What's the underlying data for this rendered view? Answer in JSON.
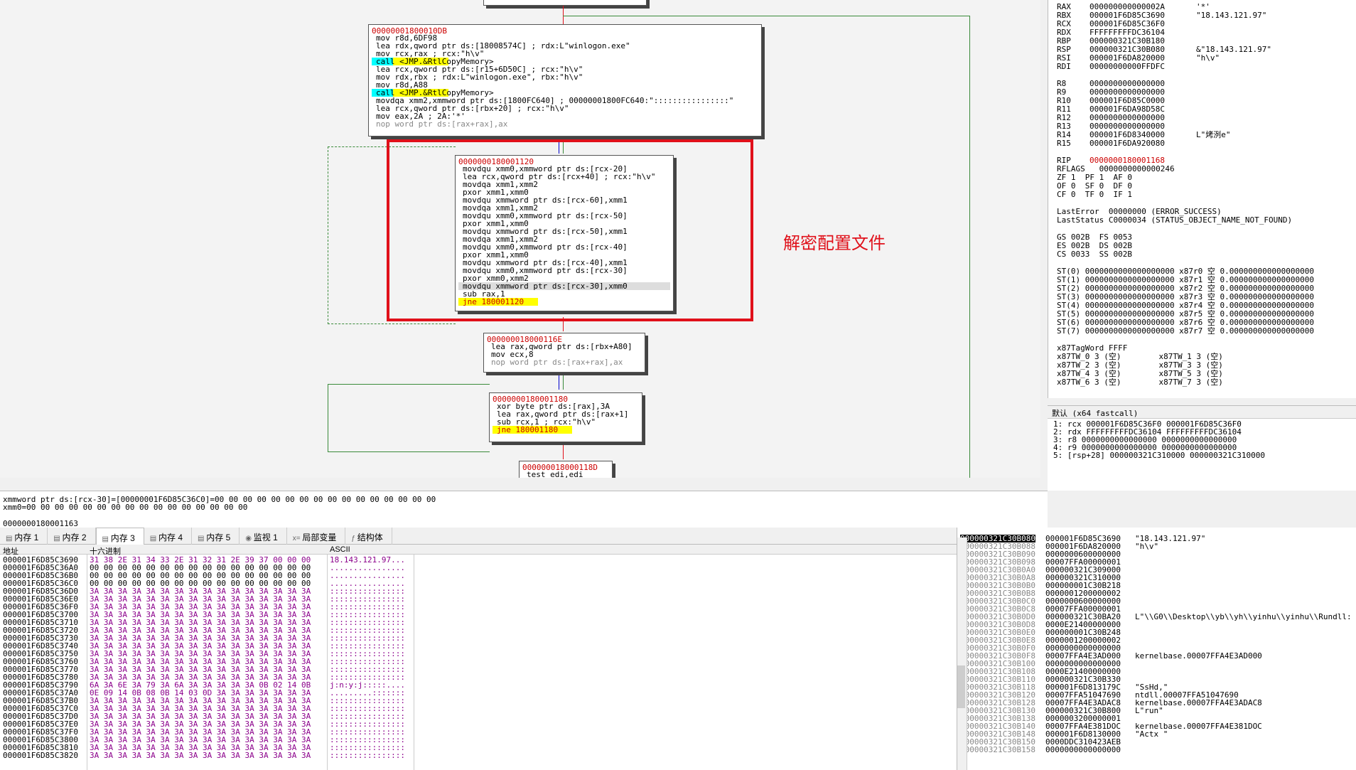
{
  "graph": {
    "block1": {
      "addr": "00000001800010DB",
      "lines": [
        [
          "kw",
          "mov r8d,6DF98"
        ],
        [
          "kw",
          "lea rdx,qword ptr ds:[18008574C] ; rdx:L\"winlogon.exe\""
        ],
        [
          "kw",
          "mov rcx,rax ; rcx:\"h\\v\""
        ],
        [
          "call",
          "call <JMP.&RtlCopyMemory>"
        ],
        [
          "kw",
          "lea rcx,qword ptr ds:[r15+6D50C] ; rcx:\"h\\v\""
        ],
        [
          "kw",
          "mov rdx,rbx ; rdx:L\"winlogon.exe\", rbx:\"h\\v\""
        ],
        [
          "kw",
          "mov r8d,A88"
        ],
        [
          "call",
          "call <JMP.&RtlCopyMemory>"
        ],
        [
          "kw",
          "movdqa xmm2,xmmword ptr ds:[1800FC640] ; 00000001800FC640:\"::::::::::::::::\""
        ],
        [
          "kw",
          "lea rcx,qword ptr ds:[rbx+20] ; rcx:\"h\\v\""
        ],
        [
          "kw",
          "mov eax,2A ; 2A:'*'"
        ],
        [
          "gray",
          "nop word ptr ds:[rax+rax],ax"
        ]
      ]
    },
    "block2": {
      "addr": "0000000180001120",
      "lines": [
        [
          "kw",
          "movdqu xmm0,xmmword ptr ds:[rcx-20]"
        ],
        [
          "kw",
          "lea rcx,qword ptr ds:[rcx+40] ; rcx:\"h\\v\""
        ],
        [
          "kw",
          "movdqa xmm1,xmm2"
        ],
        [
          "kw",
          "pxor xmm1,xmm0"
        ],
        [
          "kw",
          "movdqu xmmword ptr ds:[rcx-60],xmm1"
        ],
        [
          "kw",
          "movdqa xmm1,xmm2"
        ],
        [
          "kw",
          "movdqu xmm0,xmmword ptr ds:[rcx-50]"
        ],
        [
          "kw",
          "pxor xmm1,xmm0"
        ],
        [
          "kw",
          "movdqu xmmword ptr ds:[rcx-50],xmm1"
        ],
        [
          "kw",
          "movdqa xmm1,xmm2"
        ],
        [
          "kw",
          "movdqu xmm0,xmmword ptr ds:[rcx-40]"
        ],
        [
          "kw",
          "pxor xmm1,xmm0"
        ],
        [
          "kw",
          "movdqu xmmword ptr ds:[rcx-40],xmm1"
        ],
        [
          "kw",
          "movdqu xmm0,xmmword ptr ds:[rcx-30]"
        ],
        [
          "kw",
          "pxor xmm0,xmm2"
        ],
        [
          "hl",
          "movdqu xmmword ptr ds:[rcx-30],xmm0"
        ],
        [
          "kw",
          "sub rax,1"
        ],
        [
          "jmp",
          "jne 180001120"
        ]
      ]
    },
    "block3": {
      "addr": "000000018000116E",
      "lines": [
        [
          "kw",
          "lea rax,qword ptr ds:[rbx+A80]"
        ],
        [
          "kw",
          "mov ecx,8"
        ],
        [
          "gray",
          "nop word ptr ds:[rax+rax],ax"
        ]
      ]
    },
    "block4": {
      "addr": "0000000180001180",
      "lines": [
        [
          "kw",
          "xor byte ptr ds:[rax],3A"
        ],
        [
          "kw",
          "lea rax,qword ptr ds:[rax+1]"
        ],
        [
          "kw",
          "sub rcx,1 ; rcx:\"h\\v\""
        ],
        [
          "jmp",
          "jne 180001180"
        ]
      ]
    },
    "block5": {
      "addr": "000000018000118D",
      "lines": [
        [
          "kw",
          "test edi,edi"
        ]
      ]
    },
    "annotation": "解密配置文件"
  },
  "info": {
    "line1": "xmmword ptr ds:[rcx-30]=[00000001F6D85C36C0]=00 00 00 00 00 00 00 00 00 00 00 00 00 00 00 00",
    "line2": "xmm0=00 00 00 00 00 00 00 00 00 00 00 00 00 00 00 00",
    "line3": "0000000180001163"
  },
  "registers": [
    [
      "RAX",
      "000000000000002A",
      "'*'"
    ],
    [
      "RBX",
      "000001F6D85C3690",
      "\"18.143.121.97\""
    ],
    [
      "RCX",
      "000001F6D85C36F0",
      ""
    ],
    [
      "RDX",
      "FFFFFFFFFDC36104",
      ""
    ],
    [
      "RBP",
      "000000321C30B180",
      ""
    ],
    [
      "RSP",
      "000000321C30B080",
      "&\"18.143.121.97\""
    ],
    [
      "RSI",
      "000001F6DA820000",
      "\"h\\v\""
    ],
    [
      "RDI",
      "00000000000FFDFC",
      ""
    ],
    [
      "",
      "",
      " "
    ],
    [
      "R8",
      "0000000000000000",
      ""
    ],
    [
      "R9",
      "0000000000000000",
      ""
    ],
    [
      "R10",
      "000001F6D85C0000",
      ""
    ],
    [
      "R11",
      "000001F6DA98D58C",
      ""
    ],
    [
      "R12",
      "0000000000000000",
      ""
    ],
    [
      "R13",
      "0000000000000000",
      ""
    ],
    [
      "R14",
      "000001F6D8340000",
      "L\"烤洌e\""
    ],
    [
      "R15",
      "000001F6DA920080",
      ""
    ],
    [
      "",
      "",
      " "
    ],
    [
      "RIP",
      "0000000180001168",
      ""
    ]
  ],
  "flags_lines": [
    "RFLAGS   0000000000000246",
    "ZF 1  PF 1  AF 0",
    "OF 0  SF 0  DF 0",
    "CF 0  TF 0  IF 1",
    " ",
    "LastError  00000000 (ERROR_SUCCESS)",
    "LastStatus C0000034 (STATUS_OBJECT_NAME_NOT_FOUND)",
    " ",
    "GS 002B  FS 0053",
    "ES 002B  DS 002B",
    "CS 0033  SS 002B",
    " ",
    "ST(0) 0000000000000000000 x87r0 空 0.000000000000000000",
    "ST(1) 0000000000000000000 x87r1 空 0.000000000000000000",
    "ST(2) 0000000000000000000 x87r2 空 0.000000000000000000",
    "ST(3) 0000000000000000000 x87r3 空 0.000000000000000000",
    "ST(4) 0000000000000000000 x87r4 空 0.000000000000000000",
    "ST(5) 0000000000000000000 x87r5 空 0.000000000000000000",
    "ST(6) 0000000000000000000 x87r6 空 0.000000000000000000",
    "ST(7) 0000000000000000000 x87r7 空 0.000000000000000000",
    " ",
    "x87TagWord FFFF",
    "x87TW_0 3 (空)        x87TW_1 3 (空)",
    "x87TW_2 3 (空)        x87TW_3 3 (空)",
    "x87TW_4 3 (空)        x87TW_5 3 (空)",
    "x87TW_6 3 (空)        x87TW_7 3 (空)"
  ],
  "args": {
    "header": "默认 (x64 fastcall)",
    "lines": [
      "1: rcx 000001F6D85C36F0 000001F6D85C36F0",
      "2: rdx FFFFFFFFFDC36104 FFFFFFFFFDC36104",
      "3: r8 0000000000000000 0000000000000000",
      "4: r9 0000000000000000 0000000000000000",
      "5: [rsp+28] 000000321C310000 000000321C310000"
    ]
  },
  "tabs": [
    "内存 1",
    "内存 2",
    "内存 3",
    "内存 4",
    "内存 5",
    "监视 1",
    "局部变量",
    "结构体"
  ],
  "dump": {
    "col_addr": "地址",
    "col_hex": "十六进制",
    "col_ascii": "ASCII",
    "rows": [
      [
        "000001F6D85C3690",
        "31 38 2E 31 34 33 2E 31 32 31 2E 39 37 00 00 00",
        "18.143.121.97..."
      ],
      [
        "000001F6D85C36A0",
        "00 00 00 00 00 00 00 00 00 00 00 00 00 00 00 00",
        "................"
      ],
      [
        "000001F6D85C36B0",
        "00 00 00 00 00 00 00 00 00 00 00 00 00 00 00 00",
        "................"
      ],
      [
        "000001F6D85C36C0",
        "00 00 00 00 00 00 00 00 00 00 00 00 00 00 00 00",
        "................"
      ],
      [
        "000001F6D85C36D0",
        "3A 3A 3A 3A 3A 3A 3A 3A 3A 3A 3A 3A 3A 3A 3A 3A",
        "::::::::::::::::"
      ],
      [
        "000001F6D85C36E0",
        "3A 3A 3A 3A 3A 3A 3A 3A 3A 3A 3A 3A 3A 3A 3A 3A",
        "::::::::::::::::"
      ],
      [
        "000001F6D85C36F0",
        "3A 3A 3A 3A 3A 3A 3A 3A 3A 3A 3A 3A 3A 3A 3A 3A",
        "::::::::::::::::"
      ],
      [
        "000001F6D85C3700",
        "3A 3A 3A 3A 3A 3A 3A 3A 3A 3A 3A 3A 3A 3A 3A 3A",
        "::::::::::::::::"
      ],
      [
        "000001F6D85C3710",
        "3A 3A 3A 3A 3A 3A 3A 3A 3A 3A 3A 3A 3A 3A 3A 3A",
        "::::::::::::::::"
      ],
      [
        "000001F6D85C3720",
        "3A 3A 3A 3A 3A 3A 3A 3A 3A 3A 3A 3A 3A 3A 3A 3A",
        "::::::::::::::::"
      ],
      [
        "000001F6D85C3730",
        "3A 3A 3A 3A 3A 3A 3A 3A 3A 3A 3A 3A 3A 3A 3A 3A",
        "::::::::::::::::"
      ],
      [
        "000001F6D85C3740",
        "3A 3A 3A 3A 3A 3A 3A 3A 3A 3A 3A 3A 3A 3A 3A 3A",
        "::::::::::::::::"
      ],
      [
        "000001F6D85C3750",
        "3A 3A 3A 3A 3A 3A 3A 3A 3A 3A 3A 3A 3A 3A 3A 3A",
        "::::::::::::::::"
      ],
      [
        "000001F6D85C3760",
        "3A 3A 3A 3A 3A 3A 3A 3A 3A 3A 3A 3A 3A 3A 3A 3A",
        "::::::::::::::::"
      ],
      [
        "000001F6D85C3770",
        "3A 3A 3A 3A 3A 3A 3A 3A 3A 3A 3A 3A 3A 3A 3A 3A",
        "::::::::::::::::"
      ],
      [
        "000001F6D85C3780",
        "3A 3A 3A 3A 3A 3A 3A 3A 3A 3A 3A 3A 3A 3A 3A 3A",
        "::::::::::::::::"
      ],
      [
        "000001F6D85C3790",
        "6A 3A 6E 3A 79 3A 6A 3A 3A 3A 3A 3A 0B 02 14 0B",
        "j:n:y:j:::::...."
      ],
      [
        "000001F6D85C37A0",
        "0E 09 14 0B 08 0B 14 03 0D 3A 3A 3A 3A 3A 3A 3A",
        ".........:::::::"
      ],
      [
        "000001F6D85C37B0",
        "3A 3A 3A 3A 3A 3A 3A 3A 3A 3A 3A 3A 3A 3A 3A 3A",
        "::::::::::::::::"
      ],
      [
        "000001F6D85C37C0",
        "3A 3A 3A 3A 3A 3A 3A 3A 3A 3A 3A 3A 3A 3A 3A 3A",
        "::::::::::::::::"
      ],
      [
        "000001F6D85C37D0",
        "3A 3A 3A 3A 3A 3A 3A 3A 3A 3A 3A 3A 3A 3A 3A 3A",
        "::::::::::::::::"
      ],
      [
        "000001F6D85C37E0",
        "3A 3A 3A 3A 3A 3A 3A 3A 3A 3A 3A 3A 3A 3A 3A 3A",
        "::::::::::::::::"
      ],
      [
        "000001F6D85C37F0",
        "3A 3A 3A 3A 3A 3A 3A 3A 3A 3A 3A 3A 3A 3A 3A 3A",
        "::::::::::::::::"
      ],
      [
        "000001F6D85C3800",
        "3A 3A 3A 3A 3A 3A 3A 3A 3A 3A 3A 3A 3A 3A 3A 3A",
        "::::::::::::::::"
      ],
      [
        "000001F6D85C3810",
        "3A 3A 3A 3A 3A 3A 3A 3A 3A 3A 3A 3A 3A 3A 3A 3A",
        "::::::::::::::::"
      ],
      [
        "000001F6D85C3820",
        "3A 3A 3A 3A 3A 3A 3A 3A 3A 3A 3A 3A 3A 3A 3A 3A",
        "::::::::::::::::"
      ]
    ]
  },
  "stack": [
    [
      "000000321C30B080",
      "000001F6D85C3690",
      "\"18.143.121.97\""
    ],
    [
      "000000321C30B088",
      "000001F6DA820000",
      "\"h\\v\""
    ],
    [
      "000000321C30B090",
      "0000000600000000",
      ""
    ],
    [
      "000000321C30B098",
      "00007FFA00000001",
      ""
    ],
    [
      "000000321C30B0A0",
      "000000321C309000",
      ""
    ],
    [
      "000000321C30B0A8",
      "000000321C310000",
      ""
    ],
    [
      "000000321C30B0B0",
      "000000001C30B218",
      ""
    ],
    [
      "000000321C30B0B8",
      "0000001200000002",
      ""
    ],
    [
      "000000321C30B0C0",
      "0000000600000000",
      ""
    ],
    [
      "000000321C30B0C8",
      "00007FFA00000001",
      ""
    ],
    [
      "000000321C30B0D0",
      "000000321C30BA20",
      "L\"\\\\G0\\\\Desktop\\\\yb\\\\yh\\\\yinhu\\\\yinhu\\\\Rundll:"
    ],
    [
      "000000321C30B0D8",
      "0000E21400000000",
      ""
    ],
    [
      "000000321C30B0E0",
      "000000001C30B248",
      ""
    ],
    [
      "000000321C30B0E8",
      "0000001200000002",
      ""
    ],
    [
      "000000321C30B0F0",
      "0000000000000000",
      ""
    ],
    [
      "000000321C30B0F8",
      "00007FFA4E3AD000",
      "kernelbase.00007FFA4E3AD000"
    ],
    [
      "000000321C30B100",
      "0000000000000000",
      ""
    ],
    [
      "000000321C30B108",
      "0000E21400000000",
      ""
    ],
    [
      "000000321C30B110",
      "000000321C30B330",
      ""
    ],
    [
      "000000321C30B118",
      "000001F6D813179C",
      "\"SsHd,\""
    ],
    [
      "000000321C30B120",
      "00007FFA51047690",
      "ntdll.00007FFA51047690"
    ],
    [
      "000000321C30B128",
      "00007FFA4E3ADAC8",
      "kernelbase.00007FFA4E3ADAC8"
    ],
    [
      "000000321C30B130",
      "000000321C30B800",
      "L\"run\""
    ],
    [
      "000000321C30B138",
      "0000003200000001",
      ""
    ],
    [
      "000000321C30B140",
      "00007FFA4E381DOC",
      "kernelbase.00007FFA4E381DOC"
    ],
    [
      "000000321C30B148",
      "000001F6D8130000",
      "\"Actx \""
    ],
    [
      "000000321C30B150",
      "0000DDC310423AEB",
      ""
    ],
    [
      "000000321C30B158",
      "0000000000000000",
      ""
    ]
  ],
  "colors": {
    "red": "#e0101a",
    "green": "#3a8a3a",
    "addr": "#cc0000"
  }
}
